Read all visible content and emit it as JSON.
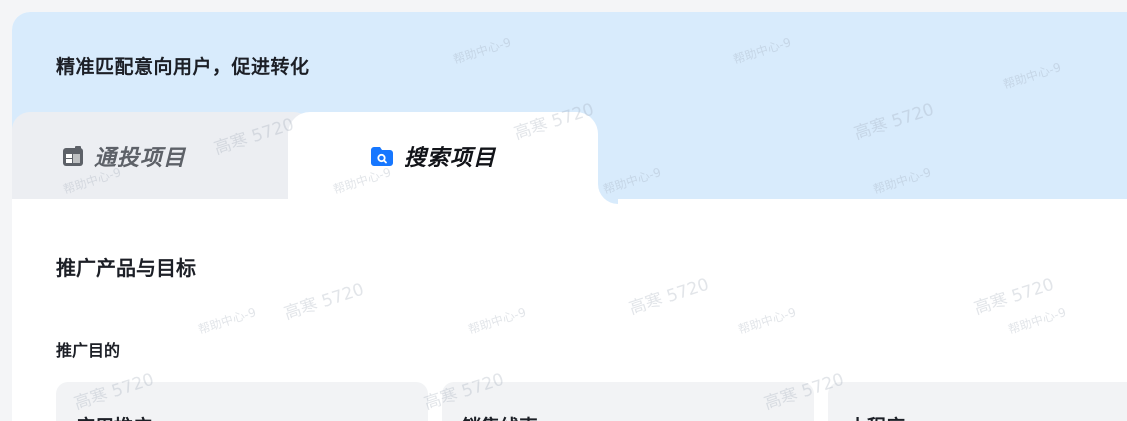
{
  "banner": {
    "title": "精准匹配意向用户，促进转化"
  },
  "tabs": [
    {
      "label": "通投项目",
      "icon": "grid-icon",
      "active": false
    },
    {
      "label": "搜索项目",
      "icon": "search-folder-icon",
      "active": true
    }
  ],
  "section": {
    "title": "推广产品与目标",
    "purpose_label": "推广目的"
  },
  "purpose_options": [
    {
      "label": "应用推广"
    },
    {
      "label": "销售线索"
    },
    {
      "label": "小程序"
    }
  ],
  "watermark": {
    "help": "帮助中心-9",
    "name": "高寒 5720"
  },
  "colors": {
    "banner_bg": "#d8ebfc",
    "tab_inactive_bg": "#eceef2",
    "accent_blue": "#1677ff"
  }
}
